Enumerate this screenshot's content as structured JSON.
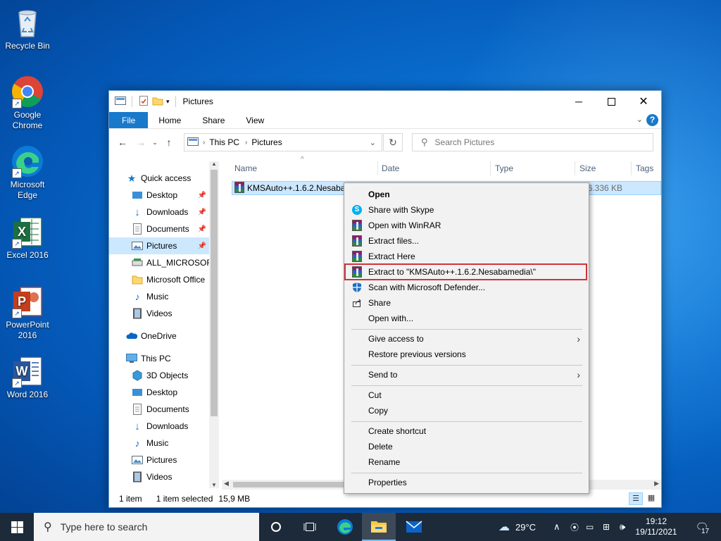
{
  "desktop": {
    "icons": [
      {
        "label": "Recycle Bin",
        "icon": "recycle-bin-icon"
      },
      {
        "label": "Google Chrome",
        "icon": "chrome-icon"
      },
      {
        "label": "Microsoft Edge",
        "icon": "edge-icon"
      },
      {
        "label": "Excel 2016",
        "icon": "excel-icon"
      },
      {
        "label": "PowerPoint 2016",
        "icon": "powerpoint-icon"
      },
      {
        "label": "Word 2016",
        "icon": "word-icon"
      }
    ]
  },
  "explorer": {
    "title": "Pictures",
    "ribbon_tabs": [
      "File",
      "Home",
      "Share",
      "View"
    ],
    "address": {
      "segments": [
        "This PC",
        "Pictures"
      ]
    },
    "search": {
      "placeholder": "Search Pictures"
    },
    "nav": {
      "quick_access": "Quick access",
      "quick_items": [
        "Desktop",
        "Downloads",
        "Documents",
        "Pictures",
        "ALL_MICROSOFT",
        "Microsoft Office",
        "Music",
        "Videos"
      ],
      "onedrive": "OneDrive",
      "this_pc": "This PC",
      "pc_items": [
        "3D Objects",
        "Desktop",
        "Documents",
        "Downloads",
        "Music",
        "Pictures",
        "Videos"
      ]
    },
    "columns": [
      "Name",
      "Date",
      "Type",
      "Size",
      "Tags"
    ],
    "files": [
      {
        "name": "KMSAuto++.1.6.2.Nesaba",
        "size": "16.336 KB"
      }
    ],
    "status": {
      "count": "1 item",
      "selected": "1 item selected",
      "size": "15,9 MB"
    }
  },
  "context_menu": {
    "items": [
      {
        "label": "Open",
        "bold": true,
        "icon": ""
      },
      {
        "label": "Share with Skype",
        "icon": "skype-icon"
      },
      {
        "label": "Open with WinRAR",
        "icon": "winrar-icon"
      },
      {
        "label": "Extract files...",
        "icon": "winrar-icon"
      },
      {
        "label": "Extract Here",
        "icon": "winrar-icon"
      },
      {
        "label": "Extract to \"KMSAuto++.1.6.2.Nesabamedia\\\"",
        "icon": "winrar-icon"
      },
      {
        "label": "Scan with Microsoft Defender...",
        "icon": "defender-icon"
      },
      {
        "label": "Share",
        "icon": "share-icon"
      },
      {
        "label": "Open with...",
        "icon": ""
      },
      {
        "label": "Give access to",
        "icon": "",
        "submenu": true
      },
      {
        "label": "Restore previous versions",
        "icon": ""
      },
      {
        "label": "Send to",
        "icon": "",
        "submenu": true
      },
      {
        "label": "Cut",
        "icon": ""
      },
      {
        "label": "Copy",
        "icon": ""
      },
      {
        "label": "Create shortcut",
        "icon": ""
      },
      {
        "label": "Delete",
        "icon": ""
      },
      {
        "label": "Rename",
        "icon": ""
      },
      {
        "label": "Properties",
        "icon": ""
      }
    ]
  },
  "taskbar": {
    "search_placeholder": "Type here to search",
    "weather": "29°C",
    "time": "19:12",
    "date": "19/11/2021",
    "notifications": "17"
  },
  "colors": {
    "accent": "#1979ca",
    "highlight": "#d2323c",
    "selection": "#cce8ff"
  }
}
